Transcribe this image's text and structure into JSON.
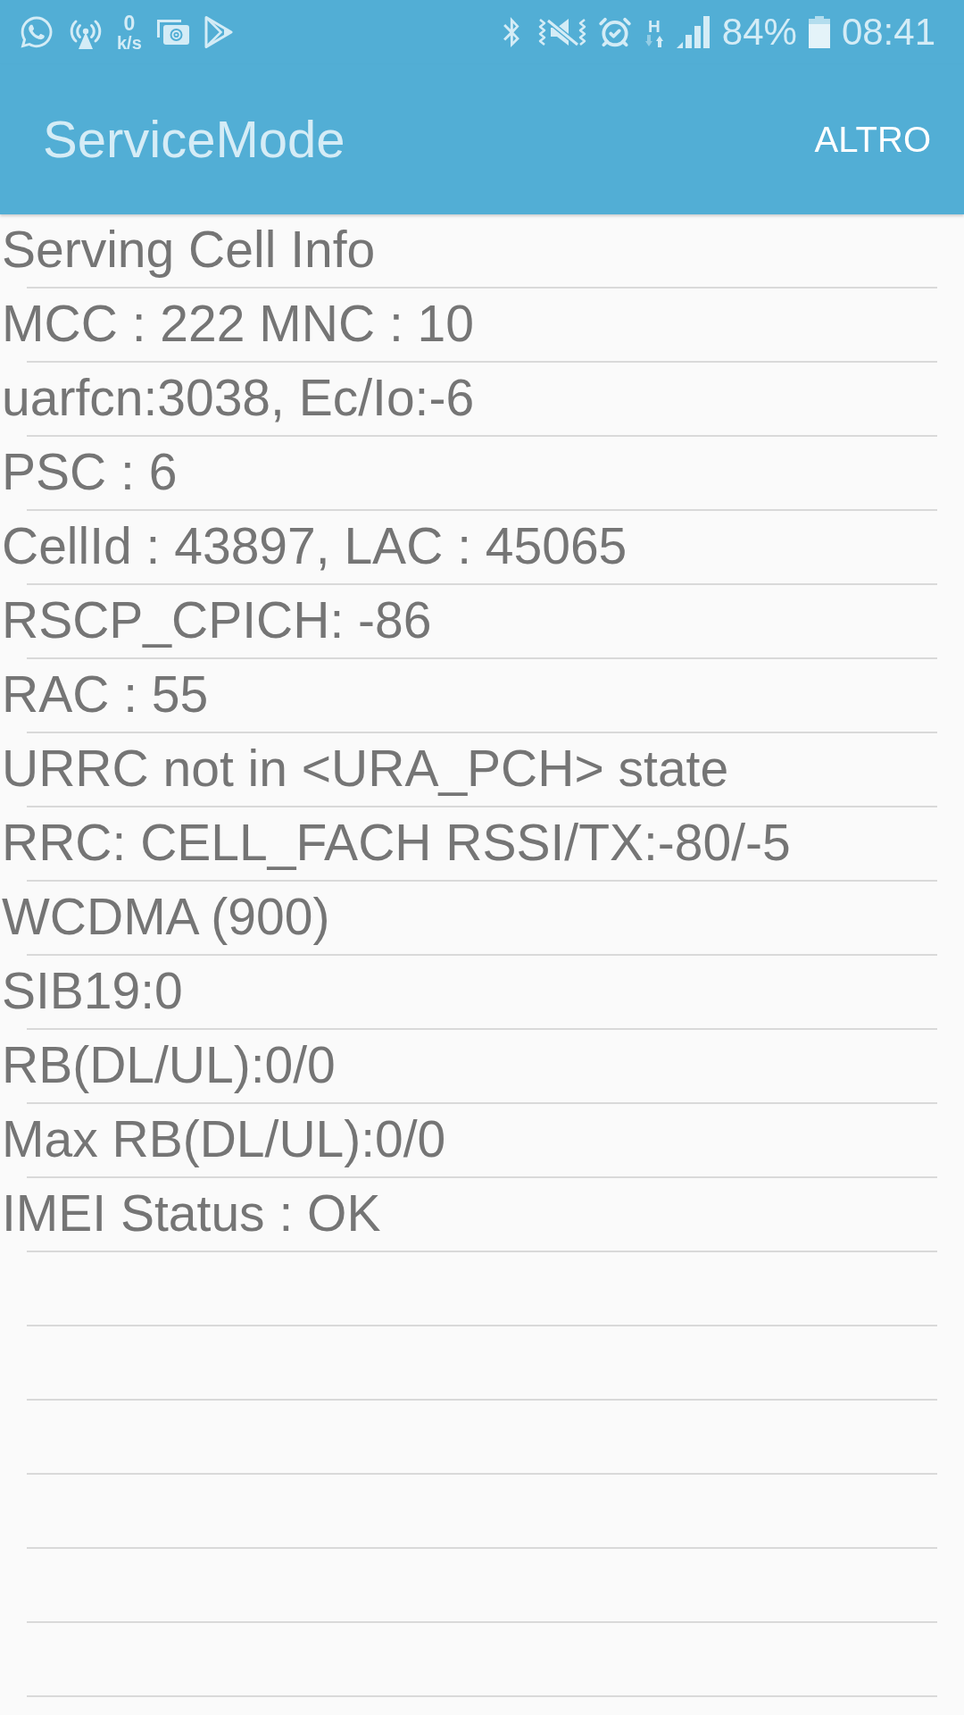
{
  "status_bar": {
    "net_speed_value": "0",
    "net_speed_unit": "k/s",
    "network_type": "H",
    "battery": "84%",
    "time": "08:41"
  },
  "app_bar": {
    "title": "ServiceMode",
    "menu_button": "ALTRO"
  },
  "info_rows": [
    "Serving Cell Info",
    "MCC : 222 MNC : 10",
    "uarfcn:3038, Ec/Io:-6",
    "PSC : 6",
    "CellId : 43897, LAC : 45065",
    "RSCP_CPICH: -86",
    "RAC : 55",
    "URRC not in <URA_PCH> state",
    "RRC: CELL_FACH RSSI/TX:-80/-5",
    "WCDMA (900)",
    "SIB19:0",
    "RB(DL/UL):0/0",
    "Max RB(DL/UL):0/0",
    "IMEI Status : OK"
  ]
}
